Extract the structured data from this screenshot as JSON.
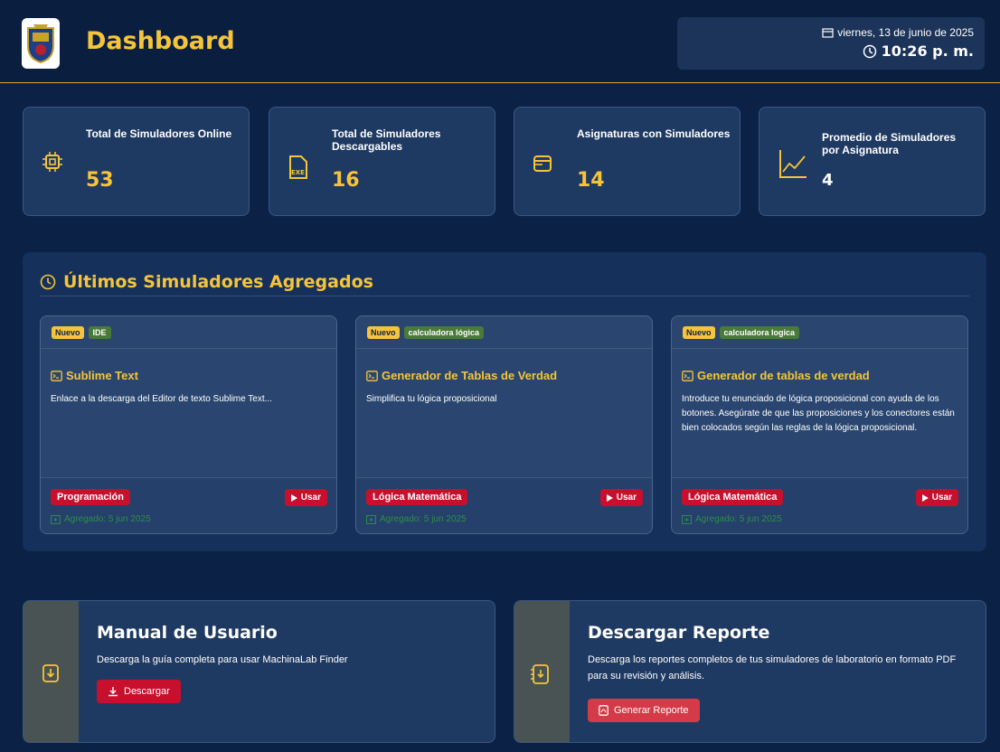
{
  "header": {
    "title": "Dashboard",
    "date": "viernes, 13 de junio de 2025",
    "time": "10:26 p. m."
  },
  "stats": [
    {
      "label": "Total de Simuladores Online",
      "value": "53",
      "icon": "chip-icon"
    },
    {
      "label": "Total de Simuladores Descargables",
      "value": "16",
      "icon": "exe-file-icon"
    },
    {
      "label": "Asignaturas con Simuladores",
      "value": "14",
      "icon": "browser-window-icon"
    },
    {
      "label": "Promedio de Simuladores por Asignatura",
      "value": "4",
      "icon": "line-chart-icon"
    }
  ],
  "latest": {
    "title": "Últimos Simuladores Agregados",
    "items": [
      {
        "badge_new": "Nuevo",
        "category": "IDE",
        "title": "Sublime Text",
        "description": "Enlace a la descarga del Editor de texto Sublime Text...",
        "subject": "Programación",
        "use_label": "Usar",
        "added": "Agregado: 5 jun 2025"
      },
      {
        "badge_new": "Nuevo",
        "category": "calculadora lógica",
        "title": "Generador de Tablas de Verdad",
        "description": "Simplifica tu lógica proposicional",
        "subject": "Lógica Matemática",
        "use_label": "Usar",
        "added": "Agregado: 5 jun 2025"
      },
      {
        "badge_new": "Nuevo",
        "category": "calculadora logica",
        "title": "Generador de tablas de verdad",
        "description": "Introduce tu enunciado de lógica proposicional con ayuda de los botones. Asegúrate de que las proposiciones y los conectores están bien colocados según las reglas de la lógica proposicional.",
        "subject": "Lógica Matemática",
        "use_label": "Usar",
        "added": "Agregado: 5 jun 2025"
      }
    ]
  },
  "manual": {
    "title": "Manual de Usuario",
    "description": "Descarga la guía completa para usar MachinaLab Finder",
    "button": "Descargar"
  },
  "report": {
    "title": "Descargar Reporte",
    "description": "Descarga los reportes completos de tus simuladores de laboratorio en formato PDF para su revisión y análisis.",
    "button": "Generar Reporte"
  },
  "colors": {
    "background": "#0b2246",
    "accent": "#f6c43a",
    "danger": "#c8102e",
    "success": "#2f8c4e"
  }
}
